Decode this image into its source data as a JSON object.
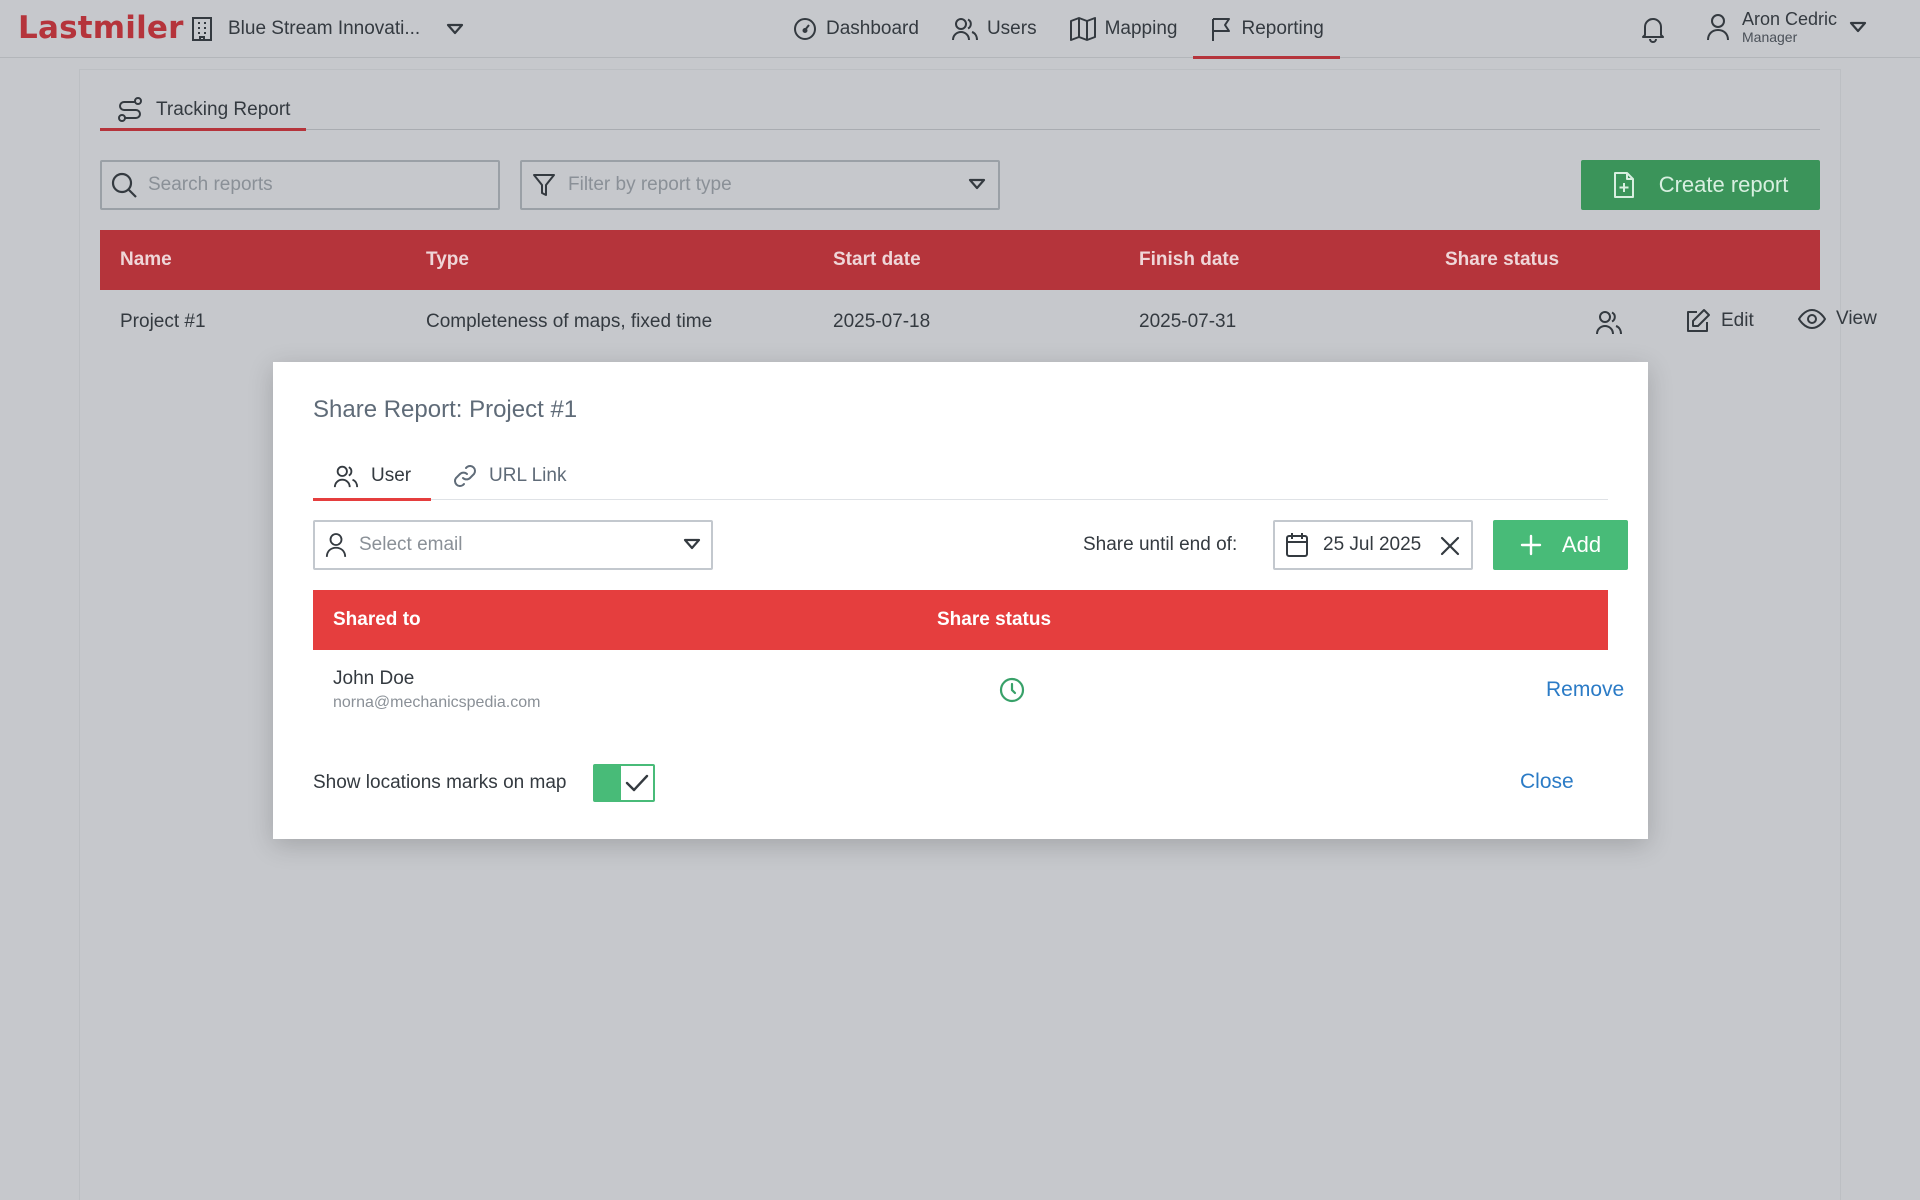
{
  "app": {
    "logo": "Lastmiler"
  },
  "org": {
    "name": "Blue Stream Innovati..."
  },
  "nav": {
    "items": [
      {
        "label": "Dashboard"
      },
      {
        "label": "Users"
      },
      {
        "label": "Mapping"
      },
      {
        "label": "Reporting",
        "active": true
      }
    ]
  },
  "user": {
    "name": "Aron Cedric",
    "role": "Manager"
  },
  "panel": {
    "tab": "Tracking Report",
    "search_placeholder": "Search reports",
    "filter_placeholder": "Filter by report type",
    "create_label": "Create report",
    "columns": [
      "Name",
      "Type",
      "Start date",
      "Finish date",
      "Share status"
    ],
    "rows": [
      {
        "name": "Project #1",
        "type": "Completeness of maps, fixed time",
        "start": "2025-07-18",
        "finish": "2025-07-31",
        "edit_label": "Edit",
        "view_label": "View"
      }
    ]
  },
  "modal": {
    "title": "Share Report: Project #1",
    "tabs": [
      {
        "label": "User",
        "active": true
      },
      {
        "label": "URL Link"
      }
    ],
    "email_placeholder": "Select email",
    "share_until_label": "Share until end of:",
    "share_until_date": "25 Jul 2025",
    "add_label": "Add",
    "columns": [
      "Shared to",
      "Share status"
    ],
    "shares": [
      {
        "name": "John Doe",
        "email": "norna@mechanicspedia.com",
        "remove_label": "Remove"
      }
    ],
    "toggle_label": "Show locations marks on map",
    "toggle_on": true,
    "close_label": "Close"
  },
  "colors": {
    "brand": "#b5343b",
    "modal_header": "#e53e3e",
    "success": "#48bb78",
    "link": "#2b7bc6"
  }
}
